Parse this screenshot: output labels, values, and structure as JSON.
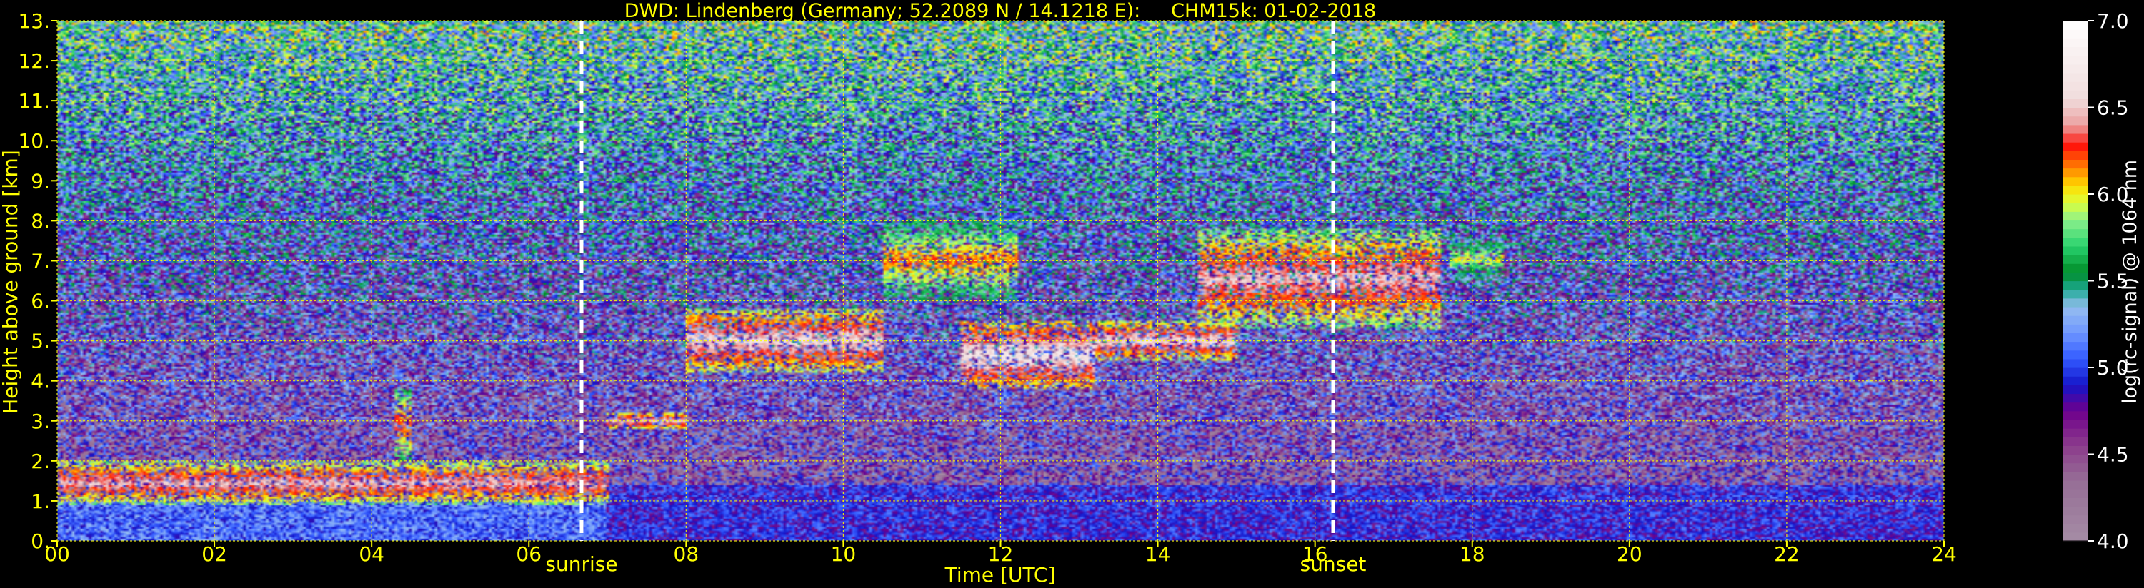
{
  "chart_data": {
    "type": "heatmap",
    "title": "DWD: Lindenberg (Germany; 52.2089 N / 14.1218 E):     CHM15k: 01-02-2018",
    "xlabel": "Time [UTC]",
    "ylabel": "Height above ground [km]",
    "xlim": [
      0,
      24
    ],
    "ylim": [
      0,
      13
    ],
    "x_tick_values": [
      0,
      2,
      4,
      6,
      8,
      10,
      12,
      14,
      16,
      18,
      20,
      22,
      24
    ],
    "x_tick_labels": [
      "00",
      "02",
      "04",
      "06",
      "08",
      "10",
      "12",
      "14",
      "16",
      "18",
      "20",
      "22",
      "24"
    ],
    "y_tick_values": [
      0,
      1,
      2,
      3,
      4,
      5,
      6,
      7,
      8,
      9,
      10,
      11,
      12,
      13
    ],
    "y_tick_labels": [
      "0.",
      "1.",
      "2.",
      "3.",
      "4.",
      "5.",
      "6.",
      "7.",
      "8.",
      "9.",
      "10.",
      "11.",
      "12.",
      "13."
    ],
    "grid": true,
    "colorbar": {
      "label": "log(rc-signal) @ 1064 nm",
      "range": [
        4.0,
        7.0
      ],
      "tick_values": [
        4.0,
        4.5,
        5.0,
        5.5,
        6.0,
        6.5,
        7.0
      ],
      "tick_labels": [
        "4.0",
        "4.5",
        "5.0",
        "5.5",
        "6.0",
        "6.5",
        "7.0"
      ]
    },
    "markers": [
      {
        "label": "sunrise",
        "x": 6.67
      },
      {
        "label": "sunset",
        "x": 16.23
      }
    ],
    "cloud_layers": [
      {
        "t0": 0.0,
        "t1": 7.0,
        "base": 0.9,
        "top": 2.0,
        "intensity": 6.5
      },
      {
        "t0": 4.3,
        "t1": 4.5,
        "base": 2.0,
        "top": 3.8,
        "intensity": 6.3
      },
      {
        "t0": 7.0,
        "t1": 8.0,
        "base": 2.8,
        "top": 3.2,
        "intensity": 6.6
      },
      {
        "t0": 8.0,
        "t1": 10.5,
        "base": 4.2,
        "top": 5.8,
        "intensity": 6.6
      },
      {
        "t0": 10.5,
        "t1": 12.2,
        "base": 6.0,
        "top": 8.0,
        "intensity": 6.2
      },
      {
        "t0": 11.5,
        "t1": 13.2,
        "base": 3.8,
        "top": 5.5,
        "intensity": 6.7
      },
      {
        "t0": 13.2,
        "t1": 15.0,
        "base": 4.5,
        "top": 5.5,
        "intensity": 6.6
      },
      {
        "t0": 14.5,
        "t1": 17.6,
        "base": 5.3,
        "top": 7.8,
        "intensity": 6.5
      },
      {
        "t0": 17.7,
        "t1": 18.4,
        "base": 6.5,
        "top": 7.6,
        "intensity": 6.0
      }
    ],
    "boundary_layer": [
      {
        "t0": 0.0,
        "t1": 7.0,
        "top": 1.0,
        "intensity": 5.1
      },
      {
        "t0": 7.0,
        "t1": 24.0,
        "top": 1.4,
        "intensity": 4.9
      }
    ],
    "colors": {
      "background": "#000000",
      "axis_text": "#ffff00",
      "grid": "#ffff00",
      "marker_line": "#ffffff"
    }
  }
}
